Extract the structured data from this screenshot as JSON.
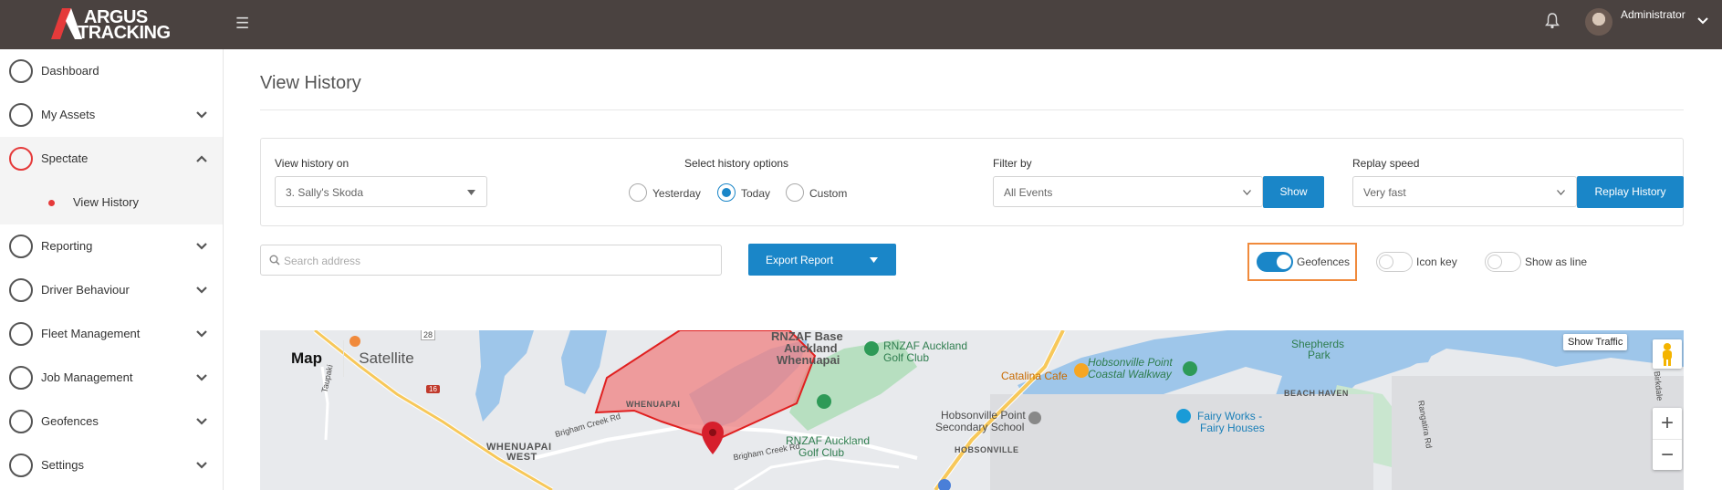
{
  "header": {
    "logo_line1": "ARGUS",
    "logo_line2": "TRACKING",
    "user_name": "Administrator"
  },
  "sidebar": {
    "items": [
      {
        "label": "Dashboard",
        "icon": "gauge-icon"
      },
      {
        "label": "My Assets",
        "icon": "assets-icon"
      },
      {
        "label": "Spectate",
        "icon": "location-pin-icon"
      },
      {
        "label": "View History",
        "icon": "dot-icon"
      },
      {
        "label": "Reporting",
        "icon": "report-icon"
      },
      {
        "label": "Driver Behaviour",
        "icon": "driver-icon"
      },
      {
        "label": "Fleet Management",
        "icon": "truck-icon"
      },
      {
        "label": "Job Management",
        "icon": "briefcase-icon"
      },
      {
        "label": "Geofences",
        "icon": "geofence-icon"
      },
      {
        "label": "Settings",
        "icon": "gear-icon"
      }
    ]
  },
  "page": {
    "title": "View History"
  },
  "filters": {
    "view_history_label": "View history on",
    "asset_value": "3.  Sally's Skoda",
    "history_options_label": "Select history options",
    "options": [
      "Yesterday",
      "Today",
      "Custom"
    ],
    "selected_option": "Today",
    "filter_by_label": "Filter by",
    "filter_value": "All Events",
    "show_button": "Show",
    "replay_speed_label": "Replay speed",
    "replay_speed_value": "Very fast",
    "replay_button": "Replay History"
  },
  "toolbar": {
    "search_placeholder": "Search address",
    "export_button": "Export Report",
    "geofences_label": "Geofences",
    "geofences_on": true,
    "icon_key_label": "Icon key",
    "icon_key_on": false,
    "show_as_line_label": "Show as line",
    "show_as_line_on": false
  },
  "map": {
    "map_button": "Map",
    "satellite_button": "Satellite",
    "traffic_button": "Show Traffic",
    "zoom_in": "+",
    "zoom_out": "−",
    "labels": {
      "rnzaf_base_1": "RNZAF Base",
      "rnzaf_base_2": "Auckland",
      "rnzaf_base_3": "Whenuapai",
      "golf1_1": "RNZAF Auckland",
      "golf1_2": "Golf Club",
      "golf2_1": "RNZAF Auckland",
      "golf2_2": "Golf Club",
      "catalina": "Catalina Cafe",
      "hobsonville_walk_1": "Hobsonville Point",
      "hobsonville_walk_2": "Coastal Walkway",
      "shepherds_1": "Shepherds",
      "shepherds_2": "Park",
      "beach_haven": "BEACH HAVEN",
      "school_1": "Hobsonville Point",
      "school_2": "Secondary School",
      "fairy_1": "Fairy Works -",
      "fairy_2": "Fairy Houses",
      "whenuapai": "WHENUAPAI",
      "whenuapai_west_1": "WHENUAPAI",
      "whenuapai_west_2": "WEST",
      "hobsonville": "HOBSONVILLE",
      "brigham1": "Brigham Creek Rd",
      "brigham2": "Brigham Creek Rd",
      "road16": "16",
      "road28": "28",
      "taupaki": "Taupaki",
      "rangatira": "Rangatira Rd",
      "birkdale": "Birkdale"
    },
    "colors": {
      "geofence_fill": "#f08080",
      "geofence_stroke": "#e02020",
      "water": "#9ec6ea",
      "park": "#b7dfc0",
      "road": "#f7c85a"
    }
  }
}
